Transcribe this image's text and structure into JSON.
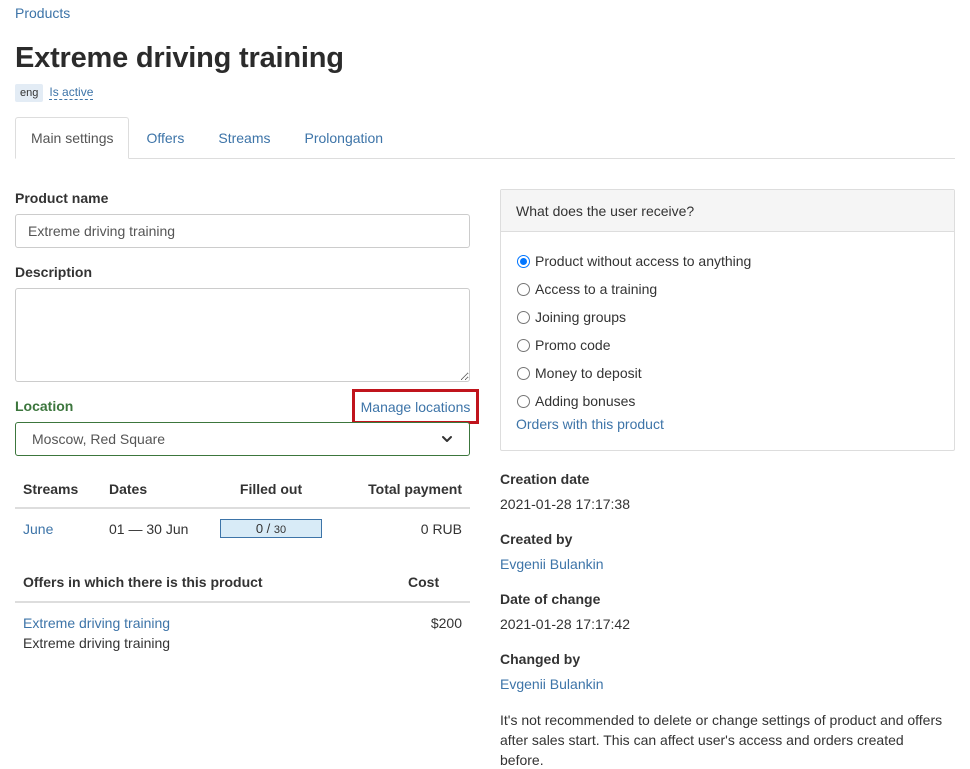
{
  "breadcrumb": {
    "label": "Products"
  },
  "page": {
    "title": "Extreme driving training",
    "lang": "eng",
    "status": "Is active"
  },
  "tabs": [
    {
      "label": "Main settings",
      "active": true
    },
    {
      "label": "Offers"
    },
    {
      "label": "Streams"
    },
    {
      "label": "Prolongation"
    }
  ],
  "form": {
    "product_name_label": "Product name",
    "product_name_value": "Extreme driving training",
    "description_label": "Description",
    "description_value": "",
    "location_label": "Location",
    "manage_locations": "Manage locations",
    "location_value": "Moscow, Red Square"
  },
  "streams_table": {
    "headers": {
      "streams": "Streams",
      "dates": "Dates",
      "filled": "Filled out",
      "total": "Total payment"
    },
    "rows": [
      {
        "name": "June",
        "dates": "01 — 30 Jun",
        "filled": "0",
        "capacity": "30",
        "filled_fraction": 0,
        "total": "0 RUB"
      }
    ]
  },
  "offers_table": {
    "headers": {
      "offer": "Offers in which there is this product",
      "cost": "Cost"
    },
    "rows": [
      {
        "link": "Extreme driving training",
        "subtitle": "Extreme driving training",
        "cost": "$200"
      }
    ]
  },
  "receive_panel": {
    "title": "What does the user receive?",
    "options": [
      {
        "label": "Product without access to anything",
        "checked": true
      },
      {
        "label": "Access to a training"
      },
      {
        "label": "Joining groups"
      },
      {
        "label": "Promo code"
      },
      {
        "label": "Money to deposit"
      },
      {
        "label": "Adding bonuses"
      }
    ],
    "orders_link": "Orders with this product"
  },
  "info": {
    "creation_date_label": "Creation date",
    "creation_date": "2021-01-28 17:17:38",
    "created_by_label": "Created by",
    "created_by": "Evgenii Bulankin",
    "change_date_label": "Date of change",
    "change_date": "2021-01-28 17:17:42",
    "changed_by_label": "Changed by",
    "changed_by": "Evgenii Bulankin",
    "note": "It's not recommended to delete or change settings of product and offers after sales start. This can affect user's access and orders created before."
  },
  "colors": {
    "link": "#3d74a8",
    "location_label": "#3c763d",
    "highlight_box": "#c0141c",
    "progress_bg": "#d8ebf7"
  }
}
